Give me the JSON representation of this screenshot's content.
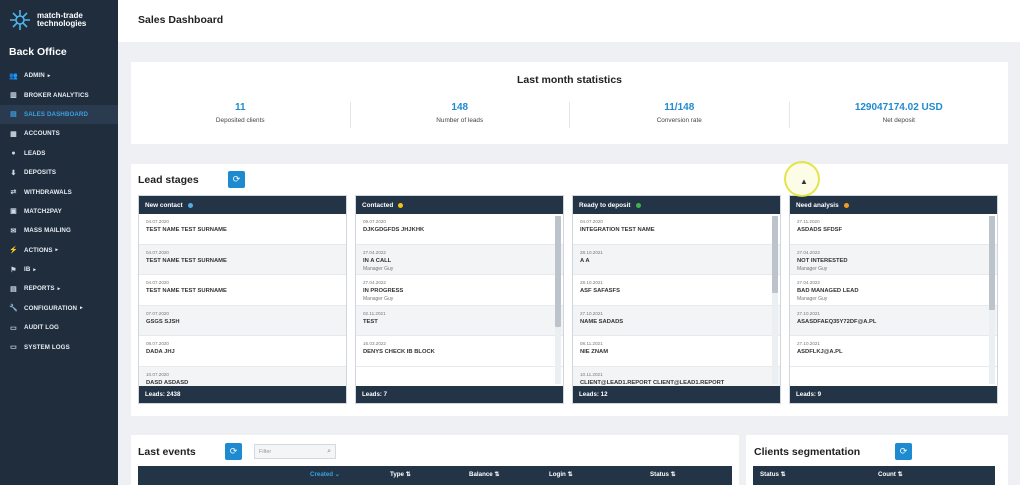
{
  "brand": {
    "logo_line1": "match-trade",
    "logo_line2": "technologies",
    "product": "Back Office"
  },
  "nav": [
    {
      "label": "ADMIN",
      "icon": "users-icon",
      "glyph": "👥",
      "submenu": true
    },
    {
      "label": "BROKER ANALYTICS",
      "icon": "chart-icon",
      "glyph": "▥",
      "submenu": false
    },
    {
      "label": "SALES DASHBOARD",
      "icon": "bar-chart-icon",
      "glyph": "▤",
      "submenu": false,
      "active": true
    },
    {
      "label": "ACCOUNTS",
      "icon": "accounts-icon",
      "glyph": "▦",
      "submenu": false
    },
    {
      "label": "LEADS",
      "icon": "leads-icon",
      "glyph": "●",
      "submenu": false
    },
    {
      "label": "DEPOSITS",
      "icon": "deposit-icon",
      "glyph": "⬇",
      "submenu": false
    },
    {
      "label": "WITHDRAWALS",
      "icon": "withdraw-icon",
      "glyph": "⇄",
      "submenu": false
    },
    {
      "label": "MATCH2PAY",
      "icon": "pay-icon",
      "glyph": "▣",
      "submenu": false
    },
    {
      "label": "MASS MAILING",
      "icon": "mail-icon",
      "glyph": "✉",
      "submenu": false
    },
    {
      "label": "ACTIONS",
      "icon": "actions-icon",
      "glyph": "⚡",
      "submenu": true
    },
    {
      "label": "IB",
      "icon": "ib-icon",
      "glyph": "⚑",
      "submenu": true
    },
    {
      "label": "REPORTS",
      "icon": "reports-icon",
      "glyph": "▤",
      "submenu": true
    },
    {
      "label": "CONFIGURATION",
      "icon": "wrench-icon",
      "glyph": "🔧",
      "submenu": true
    },
    {
      "label": "AUDIT LOG",
      "icon": "log-icon",
      "glyph": "▭",
      "submenu": false
    },
    {
      "label": "SYSTEM LOGS",
      "icon": "system-icon",
      "glyph": "▭",
      "submenu": false
    }
  ],
  "header": {
    "title": "Sales Dashboard"
  },
  "stats": {
    "title": "Last month statistics",
    "items": [
      {
        "value": "11",
        "label": "Deposited clients"
      },
      {
        "value": "148",
        "label": "Number of leads"
      },
      {
        "value": "11/148",
        "label": "Conversion rate"
      },
      {
        "value": "129047174.02 USD",
        "label": "Net deposit"
      }
    ]
  },
  "lead_stages": {
    "title": "Lead stages",
    "columns": [
      {
        "name": "New contact",
        "color": "#5aa9e6",
        "footer": "Leads: 2438",
        "scrollbar": false,
        "items": [
          {
            "date": "04.07.2020",
            "name": "TEST NAME TEST SURNAME",
            "manager": ""
          },
          {
            "date": "04.07.2020",
            "name": "TEST NAME TEST SURNAME",
            "manager": ""
          },
          {
            "date": "04.07.2020",
            "name": "TEST NAME TEST SURNAME",
            "manager": ""
          },
          {
            "date": "07.07.2020",
            "name": "GSGS SJSH",
            "manager": ""
          },
          {
            "date": "08.07.2020",
            "name": "DADA JHJ",
            "manager": ""
          },
          {
            "date": "10.07.2020",
            "name": "DASD ASDASD",
            "manager": ""
          }
        ]
      },
      {
        "name": "Contacted",
        "color": "#f0c419",
        "footer": "Leads: 7",
        "scrollbar": true,
        "thumb_top": 0,
        "thumb_height": 0.65,
        "items": [
          {
            "date": "09.07.2020",
            "name": "DJKGDGFDS JHJKHK",
            "manager": ""
          },
          {
            "date": "27.04.2022",
            "name": "IN A CALL",
            "manager": "Manager Guy"
          },
          {
            "date": "27.04.2022",
            "name": "IN PROGRESS",
            "manager": "Manager Guy"
          },
          {
            "date": "02.11.2021",
            "name": "TEST",
            "manager": ""
          },
          {
            "date": "16.03.2022",
            "name": "DENYS CHECK IB BLOCK",
            "manager": ""
          }
        ]
      },
      {
        "name": "Ready to deposit",
        "color": "#3db54a",
        "footer": "Leads: 12",
        "scrollbar": true,
        "thumb_top": 0,
        "thumb_height": 0.45,
        "items": [
          {
            "date": "04.07.2020",
            "name": "INTEGRATION TEST NAME",
            "manager": ""
          },
          {
            "date": "28.10.2021",
            "name": "A A",
            "manager": ""
          },
          {
            "date": "28.10.2021",
            "name": "ASF SAFASFS",
            "manager": ""
          },
          {
            "date": "27.10.2021",
            "name": "NAME SADADS",
            "manager": ""
          },
          {
            "date": "08.11.2021",
            "name": "NIE ZNAM",
            "manager": ""
          },
          {
            "date": "10.11.2021",
            "name": "CLIENT@LEAD1.REPORT CLIENT@LEAD1.REPORT",
            "manager": ""
          }
        ]
      },
      {
        "name": "Need analysis",
        "color": "#f39c1f",
        "footer": "Leads: 9",
        "scrollbar": true,
        "thumb_top": 0,
        "thumb_height": 0.55,
        "items": [
          {
            "date": "27.11.2020",
            "name": "ASDADS SFDSF",
            "manager": ""
          },
          {
            "date": "27.04.2022",
            "name": "NOT INTERESTED",
            "manager": "Manager Guy"
          },
          {
            "date": "27.04.2022",
            "name": "BAD MANAGED LEAD",
            "manager": "Manager Guy"
          },
          {
            "date": "27.10.2021",
            "name": "ASASDFAEQ35Y72DF@A.PL",
            "manager": ""
          },
          {
            "date": "27.10.2021",
            "name": "ASDFLKJ@A.PL",
            "manager": ""
          }
        ]
      }
    ]
  },
  "events": {
    "title": "Last events",
    "filter_placeholder": "Filter",
    "columns": [
      "Created",
      "Type",
      "Balance",
      "Login",
      "Status"
    ]
  },
  "segmentation": {
    "title": "Clients segmentation",
    "columns": [
      "Status",
      "Count"
    ]
  },
  "icons": {
    "refresh": "⟳",
    "search": "⌕",
    "sort": "⇅",
    "sort_down": "⌄",
    "caret": "▸",
    "cursor": "▲"
  }
}
